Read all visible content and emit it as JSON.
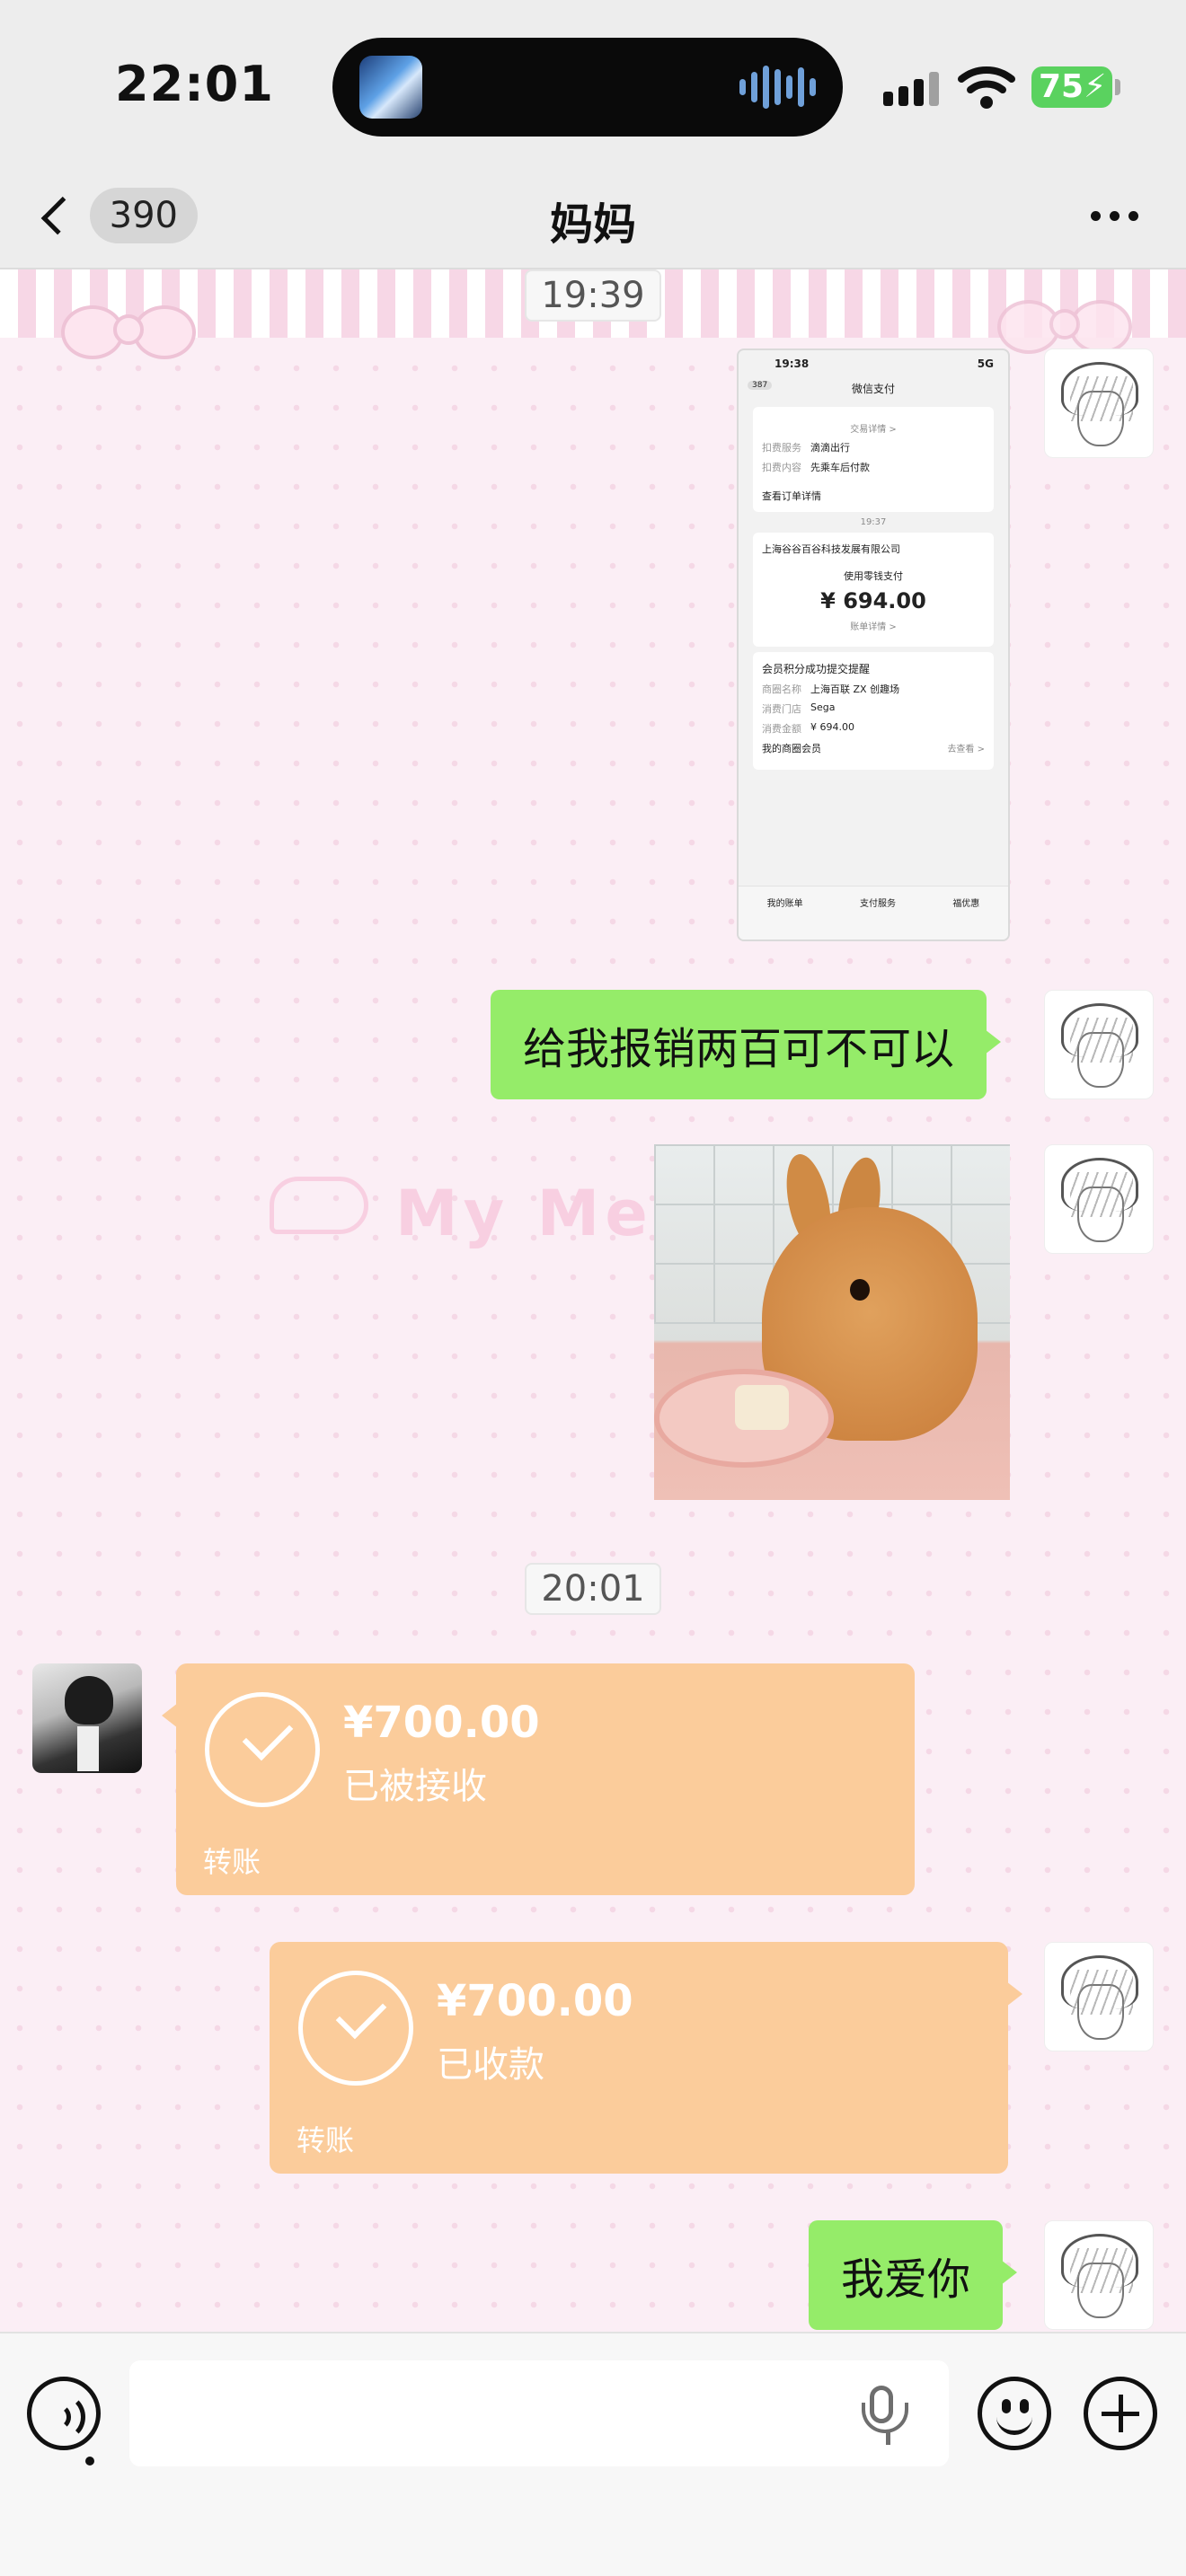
{
  "status_bar": {
    "time": "22:01",
    "battery": "75"
  },
  "nav": {
    "back_count": "390",
    "title": "妈妈"
  },
  "messages": {
    "timestamp_1": "19:39",
    "screenshot": {
      "time": "19:38",
      "net": "5G",
      "badge": "387",
      "title": "微信支付",
      "top_link": "交易详情 >",
      "row1_key": "扣费服务",
      "row1_val": "滴滴出行",
      "row2_key": "扣费内容",
      "row2_val": "先乘车后付款",
      "order_link": "查看订单详情",
      "inner_time": "19:37",
      "merchant": "上海谷谷百谷科技发展有限公司",
      "pay_method": "使用零钱支付",
      "amount": "¥ 694.00",
      "bill_link": "账单详情 >",
      "member_title": "会员积分成功提交提醒",
      "m1_key": "商圈名称",
      "m1_val": "上海百联 ZX 创趣场",
      "m2_key": "消费门店",
      "m2_val": "Sega",
      "m3_key": "消费金额",
      "m3_val": "¥ 694.00",
      "member_link": "我的商圈会员",
      "member_link_right": "去查看 >",
      "tab1": "我的账单",
      "tab2": "支付服务",
      "tab3": "福优惠"
    },
    "text_1": "给我报销两百可不可以",
    "watermark": "My Mel",
    "timestamp_2": "20:01",
    "transfer_received": {
      "amount": "¥700.00",
      "status": "已被接收",
      "label": "转账"
    },
    "transfer_collected": {
      "amount": "¥700.00",
      "status": "已收款",
      "label": "转账"
    },
    "text_2": "我爱你"
  },
  "input_bar": {
    "placeholder": ""
  },
  "colors": {
    "bubble_green": "#95ec69",
    "transfer_orange": "#fbcc9b",
    "battery_green": "#5ad25f"
  }
}
